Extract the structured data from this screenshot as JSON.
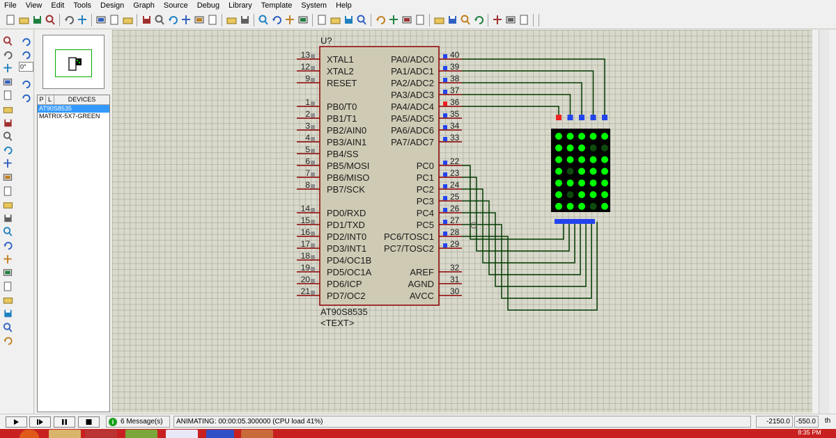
{
  "menu": [
    "File",
    "View",
    "Edit",
    "Tools",
    "Design",
    "Graph",
    "Source",
    "Debug",
    "Library",
    "Template",
    "System",
    "Help"
  ],
  "toolbar_icons": [
    "new-file-icon",
    "open-folder-icon",
    "save-icon",
    "import-icon",
    "print-icon",
    "print-area-icon",
    "refresh-icon",
    "grid-icon",
    "origin-icon",
    "pan-icon",
    "zoom-in-icon",
    "zoom-out-icon",
    "zoom-all-icon",
    "zoom-area-icon",
    "undo-icon",
    "redo-icon",
    "cut-icon",
    "copy-icon",
    "paste-icon",
    "block-copy-icon",
    "block-move-icon",
    "block-rotate-icon",
    "block-delete-icon",
    "pick-device-icon",
    "make-device-icon",
    "package-tool-icon",
    "decompose-icon",
    "wire-autorouter-icon",
    "search-tag-icon",
    "property-tool-icon",
    "new-sheet-icon",
    "remove-sheet-icon",
    "exit-to-parent-icon",
    "bill-of-materials-icon",
    "electrical-rules-icon",
    "netlist-to-ares-icon"
  ],
  "left_tools": [
    "selection-mode-icon",
    "component-mode-icon",
    "junction-dot-icon",
    "wire-label-icon",
    "text-script-icon",
    "buses-icon",
    "subcircuit-icon",
    "terminals-icon",
    "device-pins-icon",
    "graph-icon",
    "tape-recorder-icon",
    "generator-icon",
    "voltage-probe-icon",
    "current-probe-icon",
    "virtual-instruments-icon",
    "line-icon",
    "box-icon",
    "circle-icon",
    "arc-icon",
    "path-icon",
    "text-icon",
    "symbol-icon",
    "marker-icon"
  ],
  "rotation": {
    "angle": "0°"
  },
  "devices": {
    "header_p": "P",
    "header_l": "L",
    "header_label": "DEVICES",
    "items": [
      "AT90S8535",
      "MATRIX-5X7-GREEN"
    ],
    "selected_index": 0
  },
  "chip": {
    "ref": "U?",
    "part": "AT90S8535",
    "text_placeholder": "<TEXT>",
    "left_pins": [
      {
        "num": "13",
        "name": "XTAL1"
      },
      {
        "num": "12",
        "name": "XTAL2"
      },
      {
        "num": "9",
        "name": "RESET"
      },
      {
        "num": "1",
        "name": "PB0/T0"
      },
      {
        "num": "2",
        "name": "PB1/T1"
      },
      {
        "num": "3",
        "name": "PB2/AIN0"
      },
      {
        "num": "4",
        "name": "PB3/AIN1"
      },
      {
        "num": "5",
        "name": "PB4/SS"
      },
      {
        "num": "6",
        "name": "PB5/MOSI"
      },
      {
        "num": "7",
        "name": "PB6/MISO"
      },
      {
        "num": "8",
        "name": "PB7/SCK"
      },
      {
        "num": "14",
        "name": "PD0/RXD"
      },
      {
        "num": "15",
        "name": "PD1/TXD"
      },
      {
        "num": "16",
        "name": "PD2/INT0"
      },
      {
        "num": "17",
        "name": "PD3/INT1"
      },
      {
        "num": "18",
        "name": "PD4/OC1B"
      },
      {
        "num": "19",
        "name": "PD5/OC1A"
      },
      {
        "num": "20",
        "name": "PD6/ICP"
      },
      {
        "num": "21",
        "name": "PD7/OC2"
      }
    ],
    "right_pins": [
      {
        "num": "40",
        "name": "PA0/ADC0",
        "state": "low"
      },
      {
        "num": "39",
        "name": "PA1/ADC1",
        "state": "low"
      },
      {
        "num": "38",
        "name": "PA2/ADC2",
        "state": "low"
      },
      {
        "num": "37",
        "name": "PA3/ADC3",
        "state": "low"
      },
      {
        "num": "36",
        "name": "PA4/ADC4",
        "state": "high"
      },
      {
        "num": "35",
        "name": "PA5/ADC5",
        "state": "low"
      },
      {
        "num": "34",
        "name": "PA6/ADC6",
        "state": "low"
      },
      {
        "num": "33",
        "name": "PA7/ADC7",
        "state": "low"
      },
      {
        "num": "22",
        "name": "PC0",
        "state": "low"
      },
      {
        "num": "23",
        "name": "PC1",
        "state": "low"
      },
      {
        "num": "24",
        "name": "PC2",
        "state": "low"
      },
      {
        "num": "25",
        "name": "PC3",
        "state": "low"
      },
      {
        "num": "26",
        "name": "PC4",
        "state": "low"
      },
      {
        "num": "27",
        "name": "PC5",
        "state": "low"
      },
      {
        "num": "28",
        "name": "PC6/TOSC1",
        "state": "low"
      },
      {
        "num": "29",
        "name": "PC7/TOSC2",
        "state": "low"
      },
      {
        "num": "32",
        "name": "AREF",
        "state": "none"
      },
      {
        "num": "31",
        "name": "AGND",
        "state": "none"
      },
      {
        "num": "30",
        "name": "AVCC",
        "state": "none"
      }
    ]
  },
  "matrix": {
    "columns": 5,
    "rows": 7,
    "top_pin_states": [
      "high",
      "low",
      "low",
      "low",
      "low"
    ],
    "lit": [
      [
        1,
        1,
        1,
        1,
        1
      ],
      [
        1,
        1,
        1,
        0,
        0
      ],
      [
        1,
        1,
        1,
        1,
        1
      ],
      [
        1,
        0,
        1,
        1,
        1
      ],
      [
        1,
        1,
        1,
        1,
        1
      ],
      [
        1,
        0,
        1,
        1,
        1
      ],
      [
        1,
        1,
        1,
        0,
        1
      ]
    ]
  },
  "colors": {
    "body_fill": "#cfcab4",
    "body_stroke": "#8b0000",
    "wire": "#003a00",
    "pin_high": "#ee2222",
    "pin_low": "#2244ee",
    "led_on": "#00ff00",
    "led_off": "#0e4a0e"
  },
  "status": {
    "message_count": "6 Message(s)",
    "animating": "ANIMATING: 00:00:05.300000 (CPU load 41%)",
    "coord_x": "-2150.0",
    "coord_y": "-550.0",
    "units": "th"
  },
  "taskbar": {
    "clock": "8:35 PM"
  }
}
